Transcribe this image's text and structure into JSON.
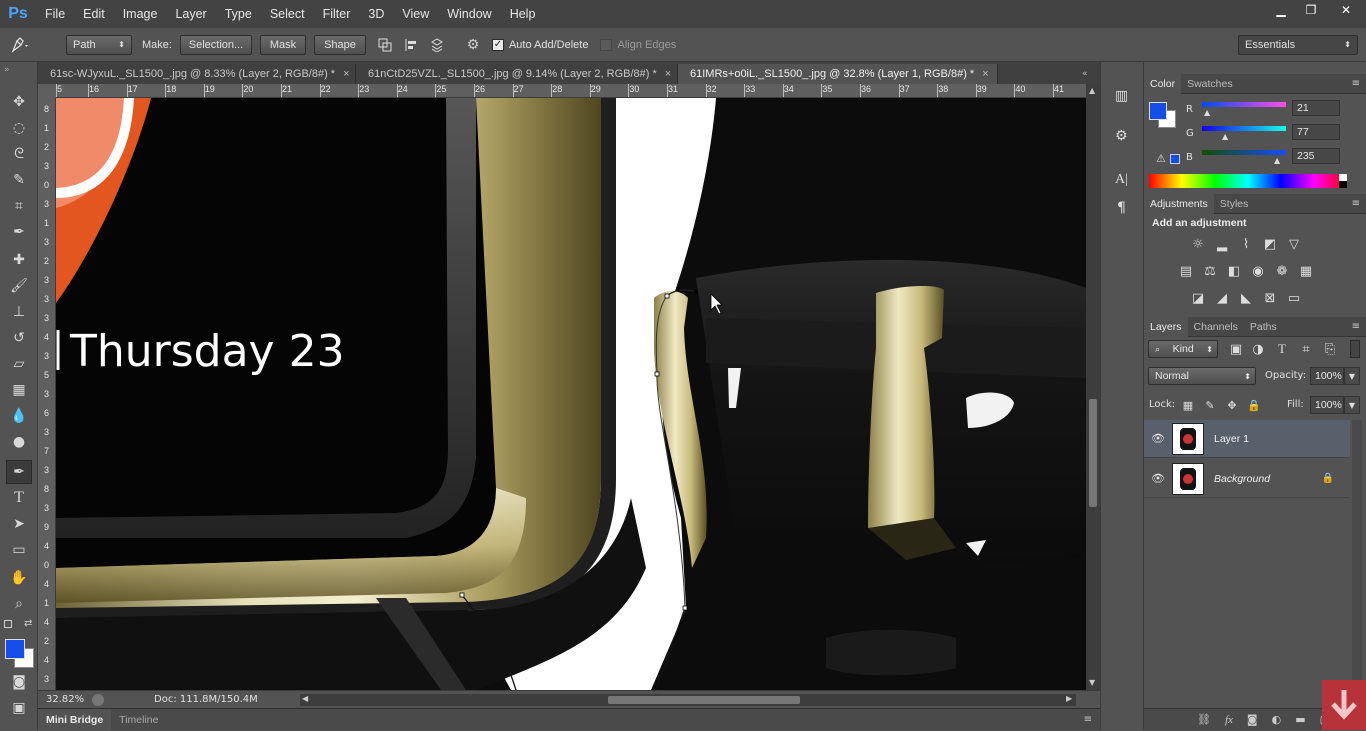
{
  "app": {
    "logo": "Ps"
  },
  "menu": [
    "File",
    "Edit",
    "Image",
    "Layer",
    "Type",
    "Select",
    "Filter",
    "3D",
    "View",
    "Window",
    "Help"
  ],
  "window_controls": {
    "minimize": "▁",
    "restore": "❐",
    "close": "✕"
  },
  "options": {
    "tool_mode": "Path",
    "make_label": "Make:",
    "selection_btn": "Selection...",
    "mask_btn": "Mask",
    "shape_btn": "Shape",
    "auto_add_delete": "Auto Add/Delete",
    "align_edges": "Align Edges",
    "workspace": "Essentials"
  },
  "tabs": [
    {
      "label": "61sc-WJyxuL._SL1500_.jpg @ 8.33% (Layer 2, RGB/8#) *",
      "close": "×"
    },
    {
      "label": "61nCtD25VZL._SL1500_.jpg @ 9.14% (Layer 2, RGB/8#) *",
      "close": "×"
    },
    {
      "label": "61IMRs+o0iL._SL1500_.jpg @ 32.8% (Layer 1, RGB/8#) *",
      "close": "×"
    }
  ],
  "ruler_h": [
    "5",
    "16",
    "17",
    "18",
    "19",
    "20",
    "21",
    "22",
    "23",
    "24",
    "25",
    "26",
    "27",
    "28",
    "29",
    "30",
    "31",
    "32",
    "33",
    "34",
    "35",
    "36",
    "37",
    "38",
    "39",
    "40",
    "41"
  ],
  "ruler_v": [
    "8",
    "1",
    "2",
    "3",
    "0",
    "3",
    "1",
    "3",
    "2",
    "3",
    "3",
    "3",
    "4",
    "3",
    "5",
    "3",
    "6",
    "3",
    "7",
    "3",
    "8",
    "3",
    "9",
    "4",
    "0",
    "4",
    "1",
    "4",
    "2",
    "4",
    "3"
  ],
  "canvas": {
    "watch_text": "Thursday 23"
  },
  "status": {
    "zoom": "32.82%",
    "doc": "Doc: 111.8M/150.4M"
  },
  "bottom_tabs": [
    "Mini Bridge",
    "Timeline"
  ],
  "color_panel": {
    "tabs": [
      "Color",
      "Swatches"
    ],
    "r_label": "R",
    "g_label": "G",
    "b_label": "B",
    "r": "21",
    "g": "77",
    "b": "235",
    "foreground": "#154deb",
    "background": "#ffffff"
  },
  "adjustments": {
    "tabs": [
      "Adjustments",
      "Styles"
    ],
    "title": "Add an adjustment"
  },
  "layers": {
    "tabs": [
      "Layers",
      "Channels",
      "Paths"
    ],
    "filter": "Kind",
    "blend": "Normal",
    "opacity_label": "Opacity:",
    "opacity": "100%",
    "lock_label": "Lock:",
    "fill_label": "Fill:",
    "fill": "100%",
    "items": [
      {
        "name": "Layer 1",
        "selected": true
      },
      {
        "name": "Background",
        "selected": false
      }
    ]
  },
  "colors": {
    "accent": "#4aa3ff",
    "selected_layer": "#58606c"
  }
}
